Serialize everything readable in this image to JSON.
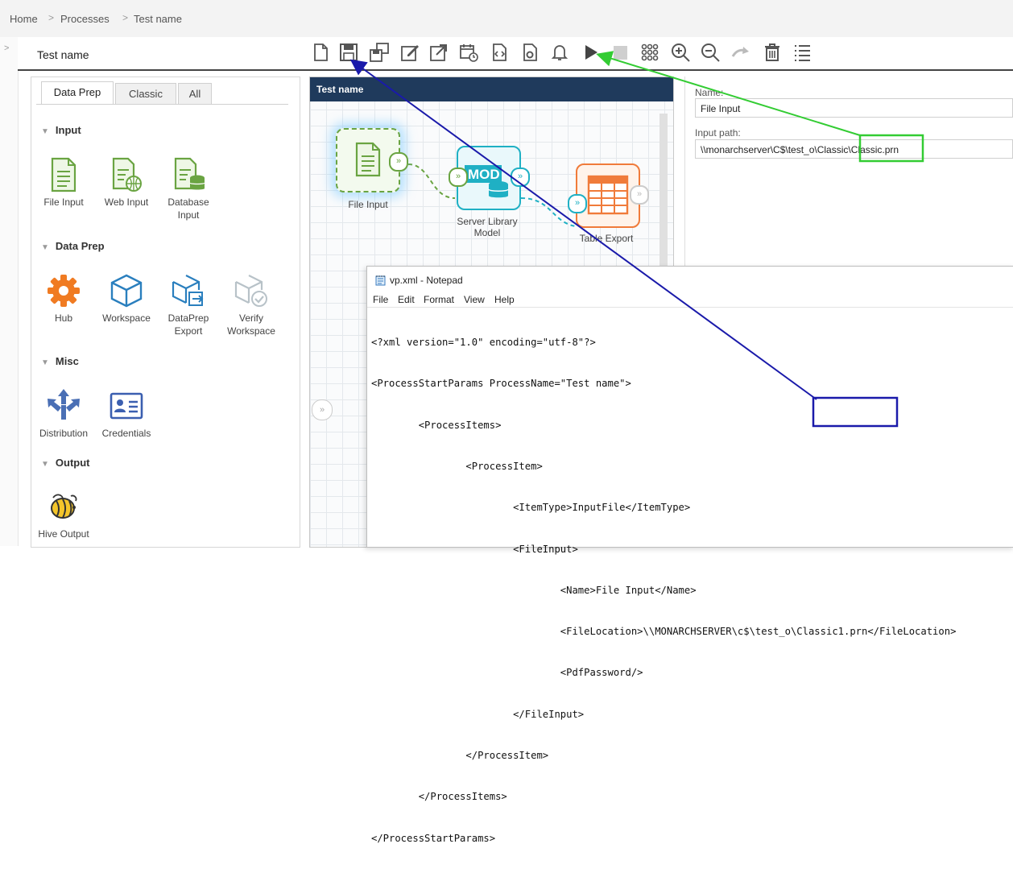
{
  "breadcrumb": {
    "home": "Home",
    "processes": "Processes",
    "current": "Test name",
    "separator": ">"
  },
  "left_edge": {
    "chevron": ">"
  },
  "process": {
    "title": "Test name"
  },
  "toolbar": {
    "icons": [
      "new-file-icon",
      "save-icon",
      "save-as-icon",
      "edit-icon",
      "open-external-icon",
      "schedule-icon",
      "code-view-icon",
      "settings-doc-icon",
      "bell-icon",
      "play-icon",
      "stop-icon",
      "grid-icon",
      "zoom-in-icon",
      "zoom-out-icon",
      "redo-arrow-icon",
      "delete-icon",
      "list-icon"
    ]
  },
  "palette": {
    "tabs": [
      "Data Prep",
      "Classic",
      "All"
    ],
    "active_tab": "Data Prep",
    "sections": {
      "input": {
        "title": "Input",
        "items": [
          {
            "label": "File Input"
          },
          {
            "label": "Web Input"
          },
          {
            "label": "Database Input"
          }
        ]
      },
      "dataprep": {
        "title": "Data Prep",
        "items": [
          {
            "label": "Hub"
          },
          {
            "label": "Workspace"
          },
          {
            "label": "DataPrep Export"
          },
          {
            "label": "Verify Workspace"
          }
        ]
      },
      "misc": {
        "title": "Misc",
        "items": [
          {
            "label": "Distribution"
          },
          {
            "label": "Credentials"
          }
        ]
      },
      "output": {
        "title": "Output",
        "items": [
          {
            "label": "Hive Output"
          }
        ]
      }
    }
  },
  "canvas": {
    "title": "Test name",
    "nodes": [
      {
        "label": "File Input",
        "icon": "file-input-icon"
      },
      {
        "label": "Server Library Model",
        "icon_text": "MOD",
        "icon": "server-library-icon"
      },
      {
        "label": "Table Export",
        "icon": "table-export-icon"
      }
    ],
    "connector_glyph": "»",
    "expander_glyph": "»"
  },
  "properties": {
    "name_label": "Name:",
    "name_value": "File Input",
    "input_path_label": "Input path:",
    "input_path_value": "\\\\monarchserver\\C$\\test_o\\Classic\\Classic.prn"
  },
  "notepad": {
    "title": "vp.xml - Notepad",
    "menu": [
      "File",
      "Edit",
      "Format",
      "View",
      "Help"
    ],
    "lines": [
      "<?xml version=\"1.0\" encoding=\"utf-8\"?>",
      "<ProcessStartParams ProcessName=\"Test name\">",
      "        <ProcessItems>",
      "                <ProcessItem>",
      "                        <ItemType>InputFile</ItemType>",
      "                        <FileInput>",
      "                                <Name>File Input</Name>",
      "                                <FileLocation>\\\\MONARCHSERVER\\c$\\test_o\\Classic1.prn</FileLocation>",
      "                                <PdfPassword/>",
      "                        </FileInput>",
      "                </ProcessItem>",
      "        </ProcessItems>",
      "</ProcessStartParams>"
    ]
  },
  "colors": {
    "green_highlight": "#33cc33",
    "blue_highlight": "#1a1aaa",
    "canvas_header": "#1f3a5c",
    "file_node": "#7ab24e",
    "mod_node": "#1fb0c4",
    "export_node": "#f07b3a"
  }
}
